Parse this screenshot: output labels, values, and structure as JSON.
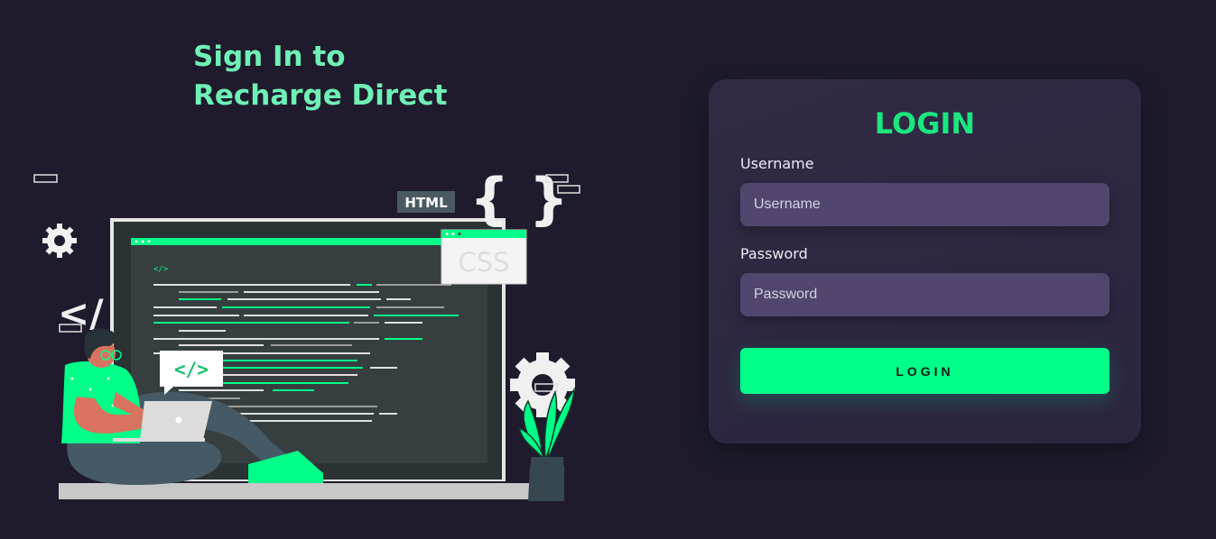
{
  "headline": {
    "line1": "Sign In to",
    "line2": "Recharge Direct"
  },
  "illustration": {
    "html_tag": "HTML",
    "css_tag": "CSS",
    "braces": "{ }",
    "code_bubble": "</>",
    "angle_brackets": "</"
  },
  "login_form": {
    "title": "LOGIN",
    "username": {
      "label": "Username",
      "placeholder": "Username",
      "value": ""
    },
    "password": {
      "label": "Password",
      "placeholder": "Password",
      "value": ""
    },
    "submit_label": "LOGIN"
  },
  "colors": {
    "background": "#1f1b2c",
    "accent": "#00ff88",
    "headline": "#6ff0b6",
    "card": "#2f283f",
    "input": "#52466e"
  }
}
